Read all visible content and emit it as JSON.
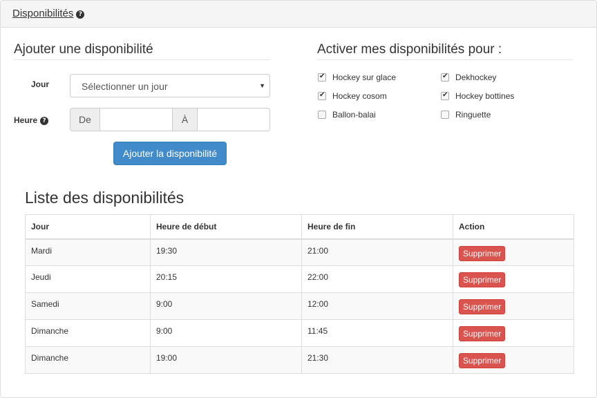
{
  "header": {
    "title": "Disponibilités"
  },
  "add_form": {
    "title": "Ajouter une disponibilité",
    "day_label": "Jour",
    "day_select_value": "Sélectionner un jour",
    "time_label": "Heure",
    "from_addon": "De",
    "to_addon": "À",
    "from_value": "",
    "to_value": "",
    "submit_label": "Ajouter la disponibilité"
  },
  "activate": {
    "title": "Activer mes disponibilités pour :",
    "sports": [
      {
        "label": "Hockey sur glace",
        "checked": true
      },
      {
        "label": "Dekhockey",
        "checked": true
      },
      {
        "label": "Hockey cosom",
        "checked": true
      },
      {
        "label": "Hockey bottines",
        "checked": true
      },
      {
        "label": "Ballon-balai",
        "checked": false
      },
      {
        "label": "Ringuette",
        "checked": false
      }
    ]
  },
  "list": {
    "title": "Liste des disponibilités",
    "columns": [
      "Jour",
      "Heure de début",
      "Heure de fin",
      "Action"
    ],
    "rows": [
      {
        "day": "Mardi",
        "start": "19:30",
        "end": "21:00",
        "action": "Supprimer"
      },
      {
        "day": "Jeudi",
        "start": "20:15",
        "end": "22:00",
        "action": "Supprimer"
      },
      {
        "day": "Samedi",
        "start": "9:00",
        "end": "12:00",
        "action": "Supprimer"
      },
      {
        "day": "Dimanche",
        "start": "9:00",
        "end": "11:45",
        "action": "Supprimer"
      },
      {
        "day": "Dimanche",
        "start": "19:00",
        "end": "21:30",
        "action": "Supprimer"
      }
    ]
  },
  "colors": {
    "primary": "#428bca",
    "danger": "#d9534f",
    "heading_bg": "#f5f5f5",
    "border": "#dddddd"
  },
  "icons": {
    "help": "question-circle-icon",
    "caret": "caret-down-icon",
    "check": "check-icon"
  }
}
